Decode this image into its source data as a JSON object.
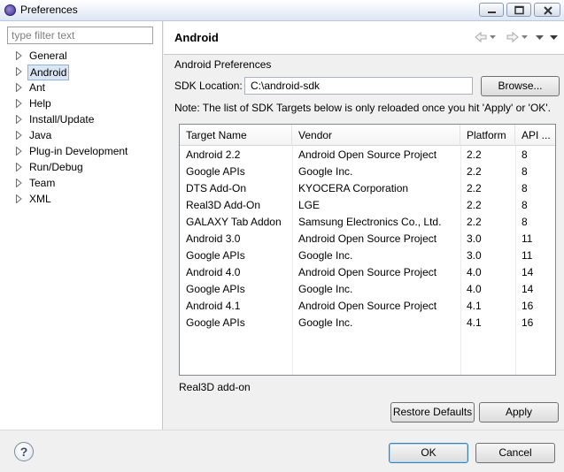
{
  "window": {
    "title": "Preferences",
    "icon": "eclipse-icon"
  },
  "sidebar": {
    "filter_placeholder": "type filter text",
    "filter_value": "",
    "items": [
      {
        "label": "General",
        "selected": false
      },
      {
        "label": "Android",
        "selected": true
      },
      {
        "label": "Ant",
        "selected": false
      },
      {
        "label": "Help",
        "selected": false
      },
      {
        "label": "Install/Update",
        "selected": false
      },
      {
        "label": "Java",
        "selected": false
      },
      {
        "label": "Plug-in Development",
        "selected": false
      },
      {
        "label": "Run/Debug",
        "selected": false
      },
      {
        "label": "Team",
        "selected": false
      },
      {
        "label": "XML",
        "selected": false
      }
    ]
  },
  "page": {
    "title": "Android",
    "section_label": "Android Preferences",
    "sdk_location_label": "SDK Location:",
    "sdk_location_value": "C:\\android-sdk",
    "browse_label": "Browse...",
    "note": "Note: The list of SDK Targets below is only reloaded once you hit 'Apply' or 'OK'.",
    "table": {
      "columns": [
        "Target Name",
        "Vendor",
        "Platform",
        "API ..."
      ],
      "rows": [
        [
          "Android 2.2",
          "Android Open Source Project",
          "2.2",
          "8"
        ],
        [
          "Google APIs",
          "Google Inc.",
          "2.2",
          "8"
        ],
        [
          "DTS Add-On",
          "KYOCERA Corporation",
          "2.2",
          "8"
        ],
        [
          "Real3D Add-On",
          "LGE",
          "2.2",
          "8"
        ],
        [
          "GALAXY Tab Addon",
          "Samsung Electronics Co., Ltd.",
          "2.2",
          "8"
        ],
        [
          "Android 3.0",
          "Android Open Source Project",
          "3.0",
          "11"
        ],
        [
          "Google APIs",
          "Google Inc.",
          "3.0",
          "11"
        ],
        [
          "Android 4.0",
          "Android Open Source Project",
          "4.0",
          "14"
        ],
        [
          "Google APIs",
          "Google Inc.",
          "4.0",
          "14"
        ],
        [
          "Android 4.1",
          "Android Open Source Project",
          "4.1",
          "16"
        ],
        [
          "Google APIs",
          "Google Inc.",
          "4.1",
          "16"
        ]
      ]
    },
    "status_text": "Real3D add-on",
    "restore_defaults_label": "Restore Defaults",
    "apply_label": "Apply"
  },
  "footer": {
    "ok_label": "OK",
    "cancel_label": "Cancel",
    "help_glyph": "?"
  },
  "colors": {
    "selection_bg": "#dbe6f5",
    "selection_border": "#8fb1db",
    "default_button_border": "#3c7fb1"
  }
}
